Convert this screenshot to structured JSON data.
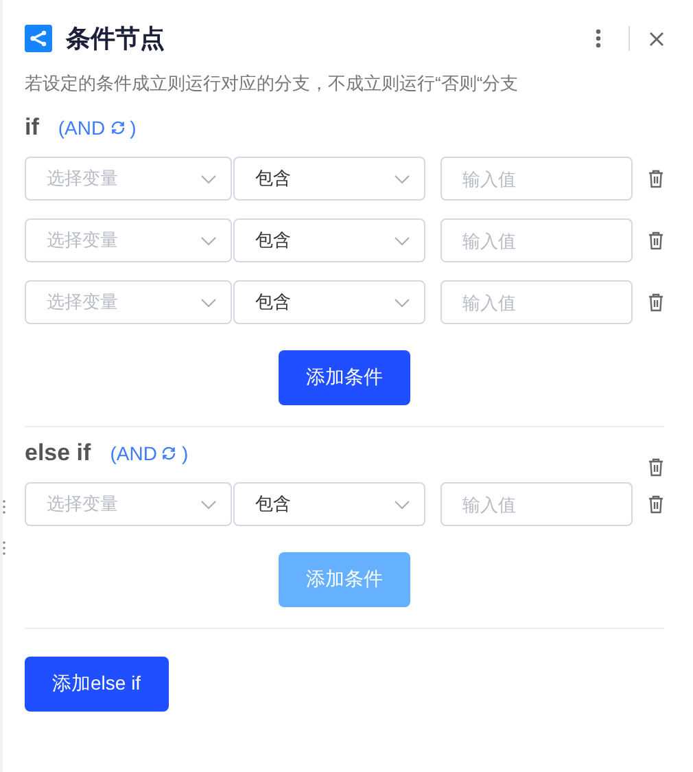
{
  "header": {
    "title": "条件节点",
    "description": "若设定的条件成立则运行对应的分支，不成立则运行“否则“分支"
  },
  "branches": [
    {
      "label": "if",
      "logic_open": "(AND",
      "logic_close": ")",
      "deletable": false,
      "conditions": [
        {
          "variable_placeholder": "选择变量",
          "operator": "包含",
          "value_placeholder": "输入值"
        },
        {
          "variable_placeholder": "选择变量",
          "operator": "包含",
          "value_placeholder": "输入值"
        },
        {
          "variable_placeholder": "选择变量",
          "operator": "包含",
          "value_placeholder": "输入值"
        }
      ],
      "add_button": {
        "label": "添加条件",
        "disabled": false
      }
    },
    {
      "label": "else if",
      "logic_open": "(AND",
      "logic_close": ")",
      "deletable": true,
      "conditions": [
        {
          "variable_placeholder": "选择变量",
          "operator": "包含",
          "value_placeholder": "输入值"
        }
      ],
      "add_button": {
        "label": "添加条件",
        "disabled": true
      }
    }
  ],
  "add_else_if_button": {
    "label": "添加else if"
  }
}
